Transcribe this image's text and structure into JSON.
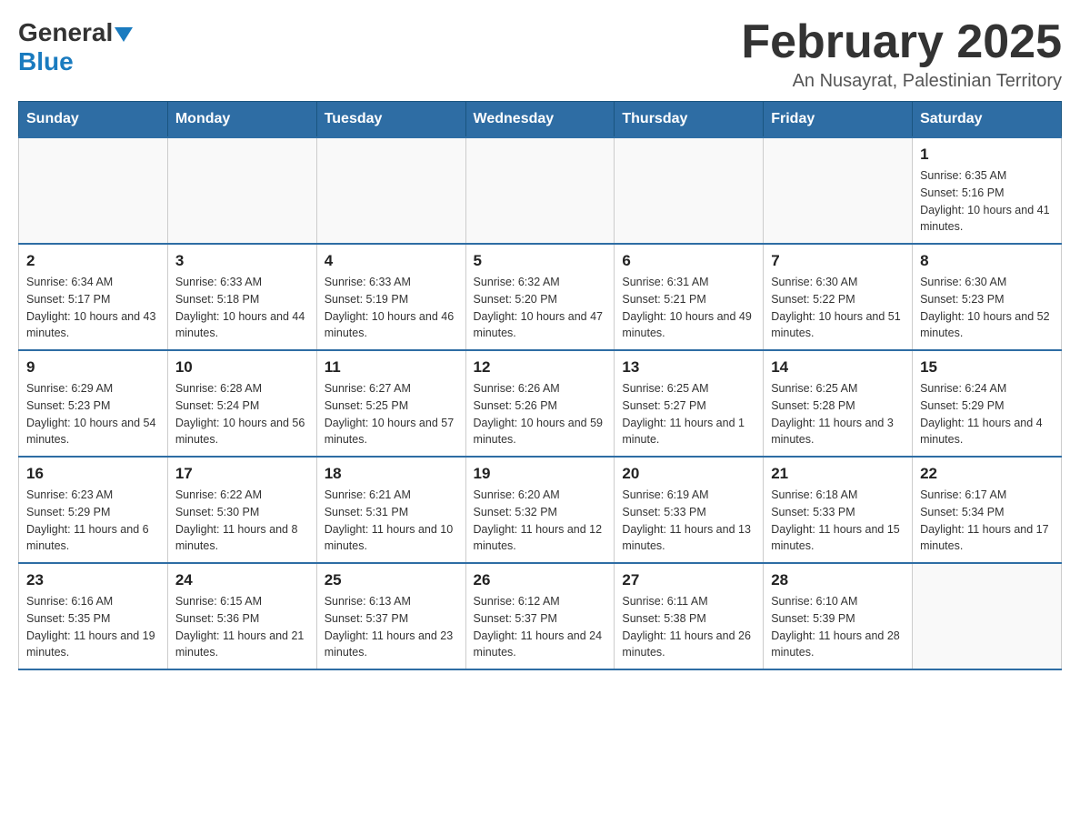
{
  "header": {
    "logo_general": "General",
    "logo_blue": "Blue",
    "month_title": "February 2025",
    "subtitle": "An Nusayrat, Palestinian Territory"
  },
  "weekdays": [
    "Sunday",
    "Monday",
    "Tuesday",
    "Wednesday",
    "Thursday",
    "Friday",
    "Saturday"
  ],
  "weeks": [
    [
      {
        "day": "",
        "info": ""
      },
      {
        "day": "",
        "info": ""
      },
      {
        "day": "",
        "info": ""
      },
      {
        "day": "",
        "info": ""
      },
      {
        "day": "",
        "info": ""
      },
      {
        "day": "",
        "info": ""
      },
      {
        "day": "1",
        "info": "Sunrise: 6:35 AM\nSunset: 5:16 PM\nDaylight: 10 hours and 41 minutes."
      }
    ],
    [
      {
        "day": "2",
        "info": "Sunrise: 6:34 AM\nSunset: 5:17 PM\nDaylight: 10 hours and 43 minutes."
      },
      {
        "day": "3",
        "info": "Sunrise: 6:33 AM\nSunset: 5:18 PM\nDaylight: 10 hours and 44 minutes."
      },
      {
        "day": "4",
        "info": "Sunrise: 6:33 AM\nSunset: 5:19 PM\nDaylight: 10 hours and 46 minutes."
      },
      {
        "day": "5",
        "info": "Sunrise: 6:32 AM\nSunset: 5:20 PM\nDaylight: 10 hours and 47 minutes."
      },
      {
        "day": "6",
        "info": "Sunrise: 6:31 AM\nSunset: 5:21 PM\nDaylight: 10 hours and 49 minutes."
      },
      {
        "day": "7",
        "info": "Sunrise: 6:30 AM\nSunset: 5:22 PM\nDaylight: 10 hours and 51 minutes."
      },
      {
        "day": "8",
        "info": "Sunrise: 6:30 AM\nSunset: 5:23 PM\nDaylight: 10 hours and 52 minutes."
      }
    ],
    [
      {
        "day": "9",
        "info": "Sunrise: 6:29 AM\nSunset: 5:23 PM\nDaylight: 10 hours and 54 minutes."
      },
      {
        "day": "10",
        "info": "Sunrise: 6:28 AM\nSunset: 5:24 PM\nDaylight: 10 hours and 56 minutes."
      },
      {
        "day": "11",
        "info": "Sunrise: 6:27 AM\nSunset: 5:25 PM\nDaylight: 10 hours and 57 minutes."
      },
      {
        "day": "12",
        "info": "Sunrise: 6:26 AM\nSunset: 5:26 PM\nDaylight: 10 hours and 59 minutes."
      },
      {
        "day": "13",
        "info": "Sunrise: 6:25 AM\nSunset: 5:27 PM\nDaylight: 11 hours and 1 minute."
      },
      {
        "day": "14",
        "info": "Sunrise: 6:25 AM\nSunset: 5:28 PM\nDaylight: 11 hours and 3 minutes."
      },
      {
        "day": "15",
        "info": "Sunrise: 6:24 AM\nSunset: 5:29 PM\nDaylight: 11 hours and 4 minutes."
      }
    ],
    [
      {
        "day": "16",
        "info": "Sunrise: 6:23 AM\nSunset: 5:29 PM\nDaylight: 11 hours and 6 minutes."
      },
      {
        "day": "17",
        "info": "Sunrise: 6:22 AM\nSunset: 5:30 PM\nDaylight: 11 hours and 8 minutes."
      },
      {
        "day": "18",
        "info": "Sunrise: 6:21 AM\nSunset: 5:31 PM\nDaylight: 11 hours and 10 minutes."
      },
      {
        "day": "19",
        "info": "Sunrise: 6:20 AM\nSunset: 5:32 PM\nDaylight: 11 hours and 12 minutes."
      },
      {
        "day": "20",
        "info": "Sunrise: 6:19 AM\nSunset: 5:33 PM\nDaylight: 11 hours and 13 minutes."
      },
      {
        "day": "21",
        "info": "Sunrise: 6:18 AM\nSunset: 5:33 PM\nDaylight: 11 hours and 15 minutes."
      },
      {
        "day": "22",
        "info": "Sunrise: 6:17 AM\nSunset: 5:34 PM\nDaylight: 11 hours and 17 minutes."
      }
    ],
    [
      {
        "day": "23",
        "info": "Sunrise: 6:16 AM\nSunset: 5:35 PM\nDaylight: 11 hours and 19 minutes."
      },
      {
        "day": "24",
        "info": "Sunrise: 6:15 AM\nSunset: 5:36 PM\nDaylight: 11 hours and 21 minutes."
      },
      {
        "day": "25",
        "info": "Sunrise: 6:13 AM\nSunset: 5:37 PM\nDaylight: 11 hours and 23 minutes."
      },
      {
        "day": "26",
        "info": "Sunrise: 6:12 AM\nSunset: 5:37 PM\nDaylight: 11 hours and 24 minutes."
      },
      {
        "day": "27",
        "info": "Sunrise: 6:11 AM\nSunset: 5:38 PM\nDaylight: 11 hours and 26 minutes."
      },
      {
        "day": "28",
        "info": "Sunrise: 6:10 AM\nSunset: 5:39 PM\nDaylight: 11 hours and 28 minutes."
      },
      {
        "day": "",
        "info": ""
      }
    ]
  ]
}
